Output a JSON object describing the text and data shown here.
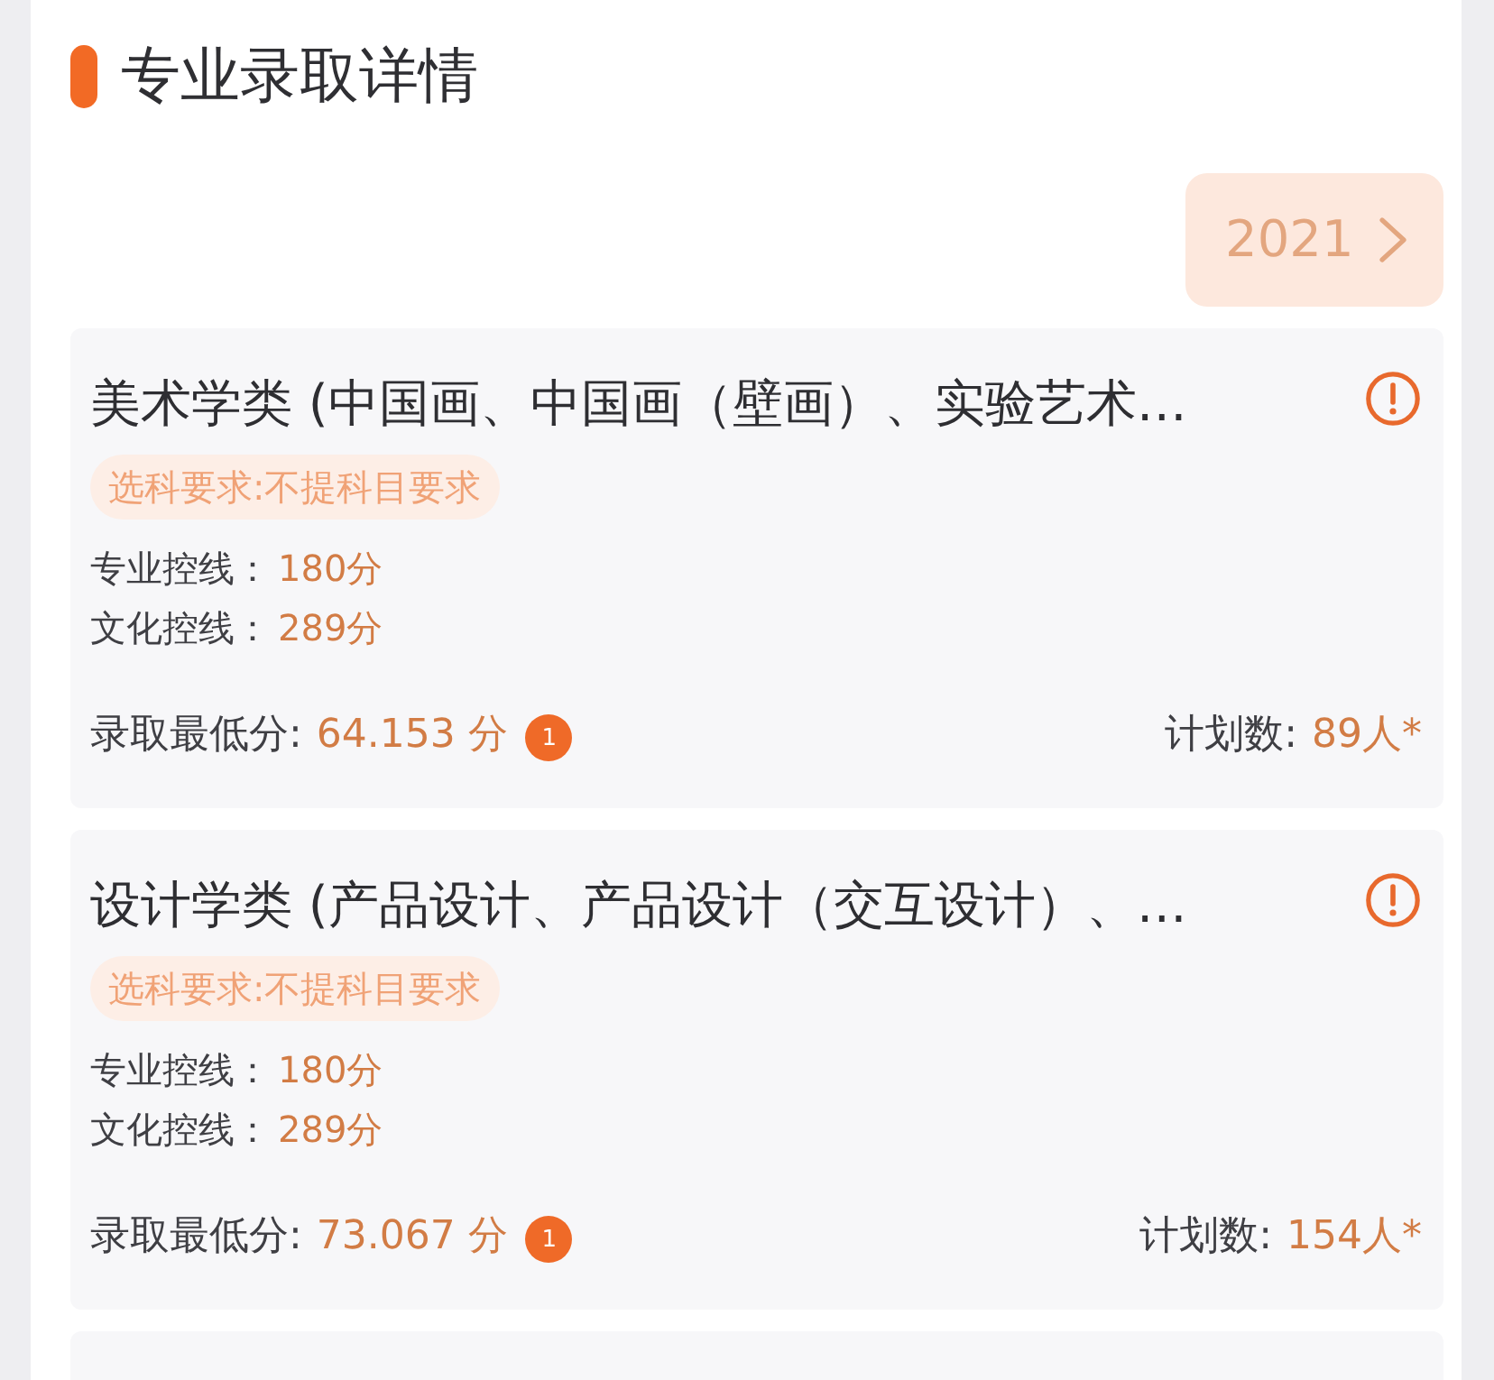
{
  "header": {
    "title": "专业录取详情"
  },
  "year_selector": {
    "label": "2021"
  },
  "majors": [
    {
      "name": "美术学类 (中国画、中国画（壁画）、实验艺术…",
      "requirement": "选科要求:不提科目要求",
      "lines": [
        {
          "label": "专业控线：",
          "value": "180分"
        },
        {
          "label": "文化控线：",
          "value": "289分"
        }
      ],
      "min_score_label": "录取最低分:",
      "min_score": "64.153 分",
      "min_score_badge": "1",
      "plan_label": "计划数:",
      "plan": "89人*"
    },
    {
      "name": "设计学类 (产品设计、产品设计（交互设计）、…",
      "requirement": "选科要求:不提科目要求",
      "lines": [
        {
          "label": "专业控线：",
          "value": "180分"
        },
        {
          "label": "文化控线：",
          "value": "289分"
        }
      ],
      "min_score_label": "录取最低分:",
      "min_score": "73.067 分",
      "min_score_badge": "1",
      "plan_label": "计划数:",
      "plan": "154人*"
    }
  ]
}
